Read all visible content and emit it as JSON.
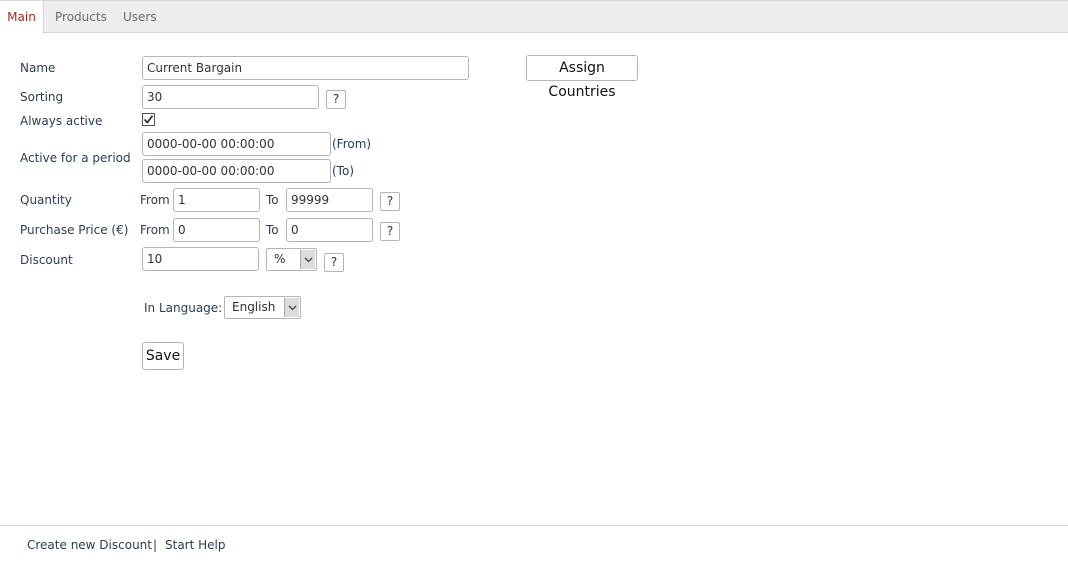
{
  "tabs": {
    "main": "Main",
    "products": "Products",
    "users": "Users"
  },
  "form": {
    "name": {
      "label": "Name",
      "value": "Current Bargain"
    },
    "sorting": {
      "label": "Sorting",
      "value": "30",
      "help": "?"
    },
    "always_active": {
      "label": "Always active",
      "checked": true
    },
    "period": {
      "label": "Active for a period",
      "from_value": "0000-00-00 00:00:00",
      "from_suffix": "(From)",
      "to_value": "0000-00-00 00:00:00",
      "to_suffix": "(To)"
    },
    "quantity": {
      "label": "Quantity",
      "from_label": "From",
      "from_value": "1",
      "to_label": "To",
      "to_value": "99999",
      "help": "?"
    },
    "purchase_price": {
      "label": "Purchase Price (€)",
      "from_label": "From",
      "from_value": "0",
      "to_label": "To",
      "to_value": "0",
      "help": "?"
    },
    "discount": {
      "label": "Discount",
      "value": "10",
      "unit": "%",
      "help": "?"
    },
    "language": {
      "label": "In Language:",
      "value": "English"
    },
    "save_label": "Save",
    "assign_countries_label": "Assign Countries"
  },
  "footer": {
    "create_link": "Create new Discount",
    "separator": "|",
    "help_link": "Start Help"
  },
  "colors": {
    "active_tab_text": "#a52a1e",
    "label_text": "#2b3e54",
    "tabbar_bg": "#eeeeee"
  }
}
